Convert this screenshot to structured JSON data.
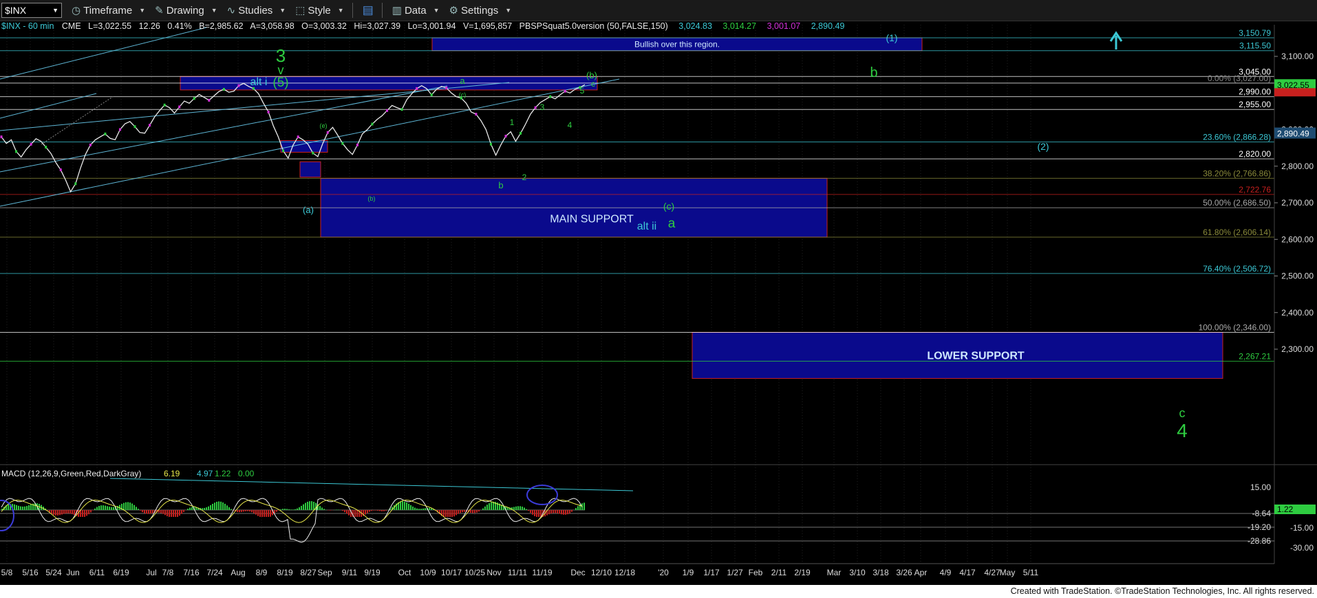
{
  "toolbar": {
    "symbol": "$INX",
    "items": [
      "Timeframe",
      "Drawing",
      "Studies",
      "Style",
      "Data",
      "Settings"
    ]
  },
  "info": {
    "title": "$INX - 60 min",
    "exchange": "CME",
    "last": "L=3,022.55",
    "change": "12.26",
    "pct": "0.41%",
    "bid": "B=2,985.62",
    "ask": "A=3,058.98",
    "open": "O=3,003.32",
    "high": "Hi=3,027.39",
    "low": "Lo=3,001.94",
    "volume": "V=1,695,857",
    "study": "PBSPSquat5.0version (50,FALSE,150)",
    "study_vals": [
      "3,024.83",
      "3,014.27",
      "3,001.07",
      "2,890.49"
    ]
  },
  "colors": {
    "cyan": "#3cc9d6",
    "green": "#2ecc40",
    "magenta": "#d32fd8",
    "navy": "#0a0a8c",
    "red": "#c8201e",
    "white": "#ffffff",
    "olive": "#8a8a3a"
  },
  "chart_data": {
    "type": "line",
    "price_axis": {
      "ticks": [
        "3,100.00",
        "2,900.00",
        "2,800.00",
        "2,700.00",
        "2,600.00",
        "2,500.00",
        "2,400.00",
        "2,300.00"
      ],
      "ylim": [
        2220,
        3170
      ]
    },
    "date_axis": [
      "5/8",
      "5/16",
      "5/24",
      "Jun",
      "6/11",
      "6/19",
      "Jul",
      "7/8",
      "7/16",
      "7/24",
      "Aug",
      "8/9",
      "8/19",
      "8/27",
      "Sep",
      "9/11",
      "9/19",
      "Oct",
      "10/9",
      "10/17",
      "10/25",
      "Nov",
      "11/11",
      "11/19",
      "Dec",
      "12/10",
      "12/18",
      "'20",
      "1/9",
      "1/17",
      "1/27",
      "Feb",
      "2/11",
      "2/19",
      "Mar",
      "3/10",
      "3/18",
      "3/26",
      "Apr",
      "4/9",
      "4/17",
      "4/27",
      "May",
      "5/11"
    ],
    "levels": [
      {
        "label": "3,150.79",
        "value": 3150.79
      },
      {
        "label": "3,115.50",
        "value": 3115.5
      },
      {
        "label": "3,045.00",
        "value": 3045
      },
      {
        "label": "0.00% (3,027.00)",
        "value": 3027
      },
      {
        "label": "2,990.00",
        "value": 2990
      },
      {
        "label": "2,955.00",
        "value": 2955
      },
      {
        "label": "23.60% (2,866.28)",
        "value": 2866.28
      },
      {
        "label": "2,820.00",
        "value": 2820
      },
      {
        "label": "38.20% (2,766.86)",
        "value": 2766.86
      },
      {
        "label": "2,722.76",
        "value": 2722.76
      },
      {
        "label": "50.00% (2,686.50)",
        "value": 2686.5
      },
      {
        "label": "61.80% (2,606.14)",
        "value": 2606.14
      },
      {
        "label": "76.40% (2,506.72)",
        "value": 2506.72
      },
      {
        "label": "100.00% (2,346.00)",
        "value": 2346
      },
      {
        "label": "2,267.21",
        "value": 2267.21
      }
    ],
    "price_tags": [
      "3,022.55",
      "2,890.49"
    ],
    "zones": [
      {
        "label": "Bullish over this region.",
        "top": 3150.79,
        "bottom": 3115.5
      },
      {
        "label": "MAIN SUPPORT",
        "top": 2766.86,
        "bottom": 2606.14
      },
      {
        "label": "LOWER SUPPORT",
        "top": 2346,
        "bottom": 2220
      }
    ],
    "wave_labels": [
      "3",
      "v",
      "(5)",
      "alt i",
      "a",
      "(b)",
      "c",
      "b",
      "(1)",
      "(2)",
      "(a)",
      "(c)",
      "a",
      "alt ii",
      "b",
      "1",
      "2",
      "3",
      "4",
      "5",
      "c",
      "4",
      "(e)",
      "(b)",
      "(c)"
    ],
    "price_series": [
      2880,
      2862,
      2872,
      2840,
      2825,
      2845,
      2860,
      2875,
      2868,
      2852,
      2835,
      2810,
      2790,
      2762,
      2730,
      2752,
      2795,
      2832,
      2858,
      2872,
      2880,
      2888,
      2876,
      2872,
      2900,
      2916,
      2922,
      2908,
      2892,
      2890,
      2912,
      2935,
      2952,
      2967,
      2960,
      2945,
      2962,
      2978,
      2972,
      2985,
      2996,
      2988,
      2980,
      2992,
      3004,
      3010,
      3002,
      3005,
      3020,
      3026,
      3018,
      3012,
      2998,
      2972,
      2948,
      2910,
      2880,
      2842,
      2822,
      2858,
      2880,
      2872,
      2860,
      2836,
      2826,
      2862,
      2892,
      2906,
      2885,
      2862,
      2845,
      2832,
      2858,
      2888,
      2900,
      2915,
      2928,
      2938,
      2952,
      2966,
      2960,
      2955,
      2982,
      2998,
      3012,
      3020,
      3012,
      2995,
      3010,
      3018,
      3014,
      3000,
      2990,
      2986,
      2972,
      2948,
      2942,
      2924,
      2900,
      2860,
      2830,
      2858,
      2882,
      2894,
      2868,
      2890,
      2915,
      2942,
      2960,
      2974,
      2982,
      2990,
      2984,
      2995,
      3005,
      3000,
      3010,
      3015,
      3022.55
    ],
    "macd": {
      "label": "MACD (12,26,9,Green,Red,DarkGray)",
      "values": [
        "6.19",
        "4.97",
        "1.22",
        "0.00"
      ],
      "ticks": [
        "15.00",
        "-8.64",
        "-15.00",
        "-19.20",
        "-28.86",
        "-30.00"
      ],
      "tag": "1.22"
    }
  },
  "footer": "Created with TradeStation. ©TradeStation Technologies, Inc. All rights reserved."
}
